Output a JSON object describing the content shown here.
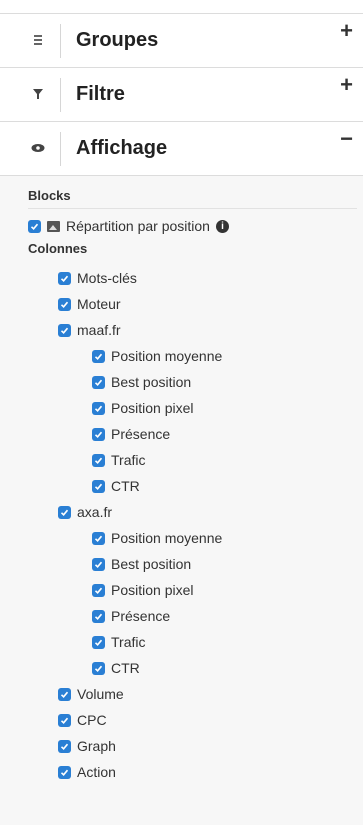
{
  "sections": {
    "groupes": {
      "title": "Groupes",
      "toggle": "+"
    },
    "filtre": {
      "title": "Filtre",
      "toggle": "+"
    },
    "affichage": {
      "title": "Affichage",
      "toggle": "−"
    }
  },
  "affichage": {
    "blocks_label": "Blocks",
    "blocks": [
      {
        "label": "Répartition par position",
        "checked": true
      }
    ],
    "colonnes_label": "Colonnes",
    "columns": [
      {
        "label": "Mots-clés",
        "level": 0,
        "checked": true
      },
      {
        "label": "Moteur",
        "level": 0,
        "checked": true
      },
      {
        "label": "maaf.fr",
        "level": 0,
        "checked": true
      },
      {
        "label": "Position moyenne",
        "level": 1,
        "checked": true
      },
      {
        "label": "Best position",
        "level": 1,
        "checked": true
      },
      {
        "label": "Position pixel",
        "level": 1,
        "checked": true
      },
      {
        "label": "Présence",
        "level": 1,
        "checked": true
      },
      {
        "label": "Trafic",
        "level": 1,
        "checked": true
      },
      {
        "label": "CTR",
        "level": 1,
        "checked": true
      },
      {
        "label": "axa.fr",
        "level": 0,
        "checked": true
      },
      {
        "label": "Position moyenne",
        "level": 1,
        "checked": true
      },
      {
        "label": "Best position",
        "level": 1,
        "checked": true
      },
      {
        "label": "Position pixel",
        "level": 1,
        "checked": true
      },
      {
        "label": "Présence",
        "level": 1,
        "checked": true
      },
      {
        "label": "Trafic",
        "level": 1,
        "checked": true
      },
      {
        "label": "CTR",
        "level": 1,
        "checked": true
      },
      {
        "label": "Volume",
        "level": 0,
        "checked": true
      },
      {
        "label": "CPC",
        "level": 0,
        "checked": true
      },
      {
        "label": "Graph",
        "level": 0,
        "checked": true
      },
      {
        "label": "Action",
        "level": 0,
        "checked": true
      }
    ]
  },
  "colors": {
    "checkbox": "#2a7fd4",
    "header_bg": "#ffffff",
    "panel_bg": "#f7f7f7"
  },
  "icons": {
    "groupes": "list-icon",
    "filtre": "filter-icon",
    "affichage": "eye-icon",
    "block_item": "image-icon",
    "info": "info-icon"
  }
}
